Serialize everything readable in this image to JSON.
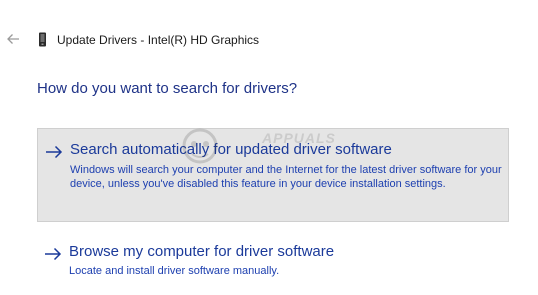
{
  "window": {
    "title": "Update Drivers - Intel(R) HD Graphics"
  },
  "main": {
    "heading": "How do you want to search for drivers?",
    "options": [
      {
        "title": "Search automatically for updated driver software",
        "description": "Windows will search your computer and the Internet for the latest driver software for your device, unless you've disabled this feature in your device installation settings.",
        "selected": true,
        "icon": "arrow-right-icon"
      },
      {
        "title": "Browse my computer for driver software",
        "description": "Locate and install driver software manually.",
        "selected": false,
        "icon": "arrow-right-icon"
      }
    ]
  },
  "watermark": {
    "text": "APPUALS"
  },
  "colors": {
    "link": "#1b3a9a",
    "heading": "#1e3287",
    "selected_bg": "#e5e5e5"
  }
}
